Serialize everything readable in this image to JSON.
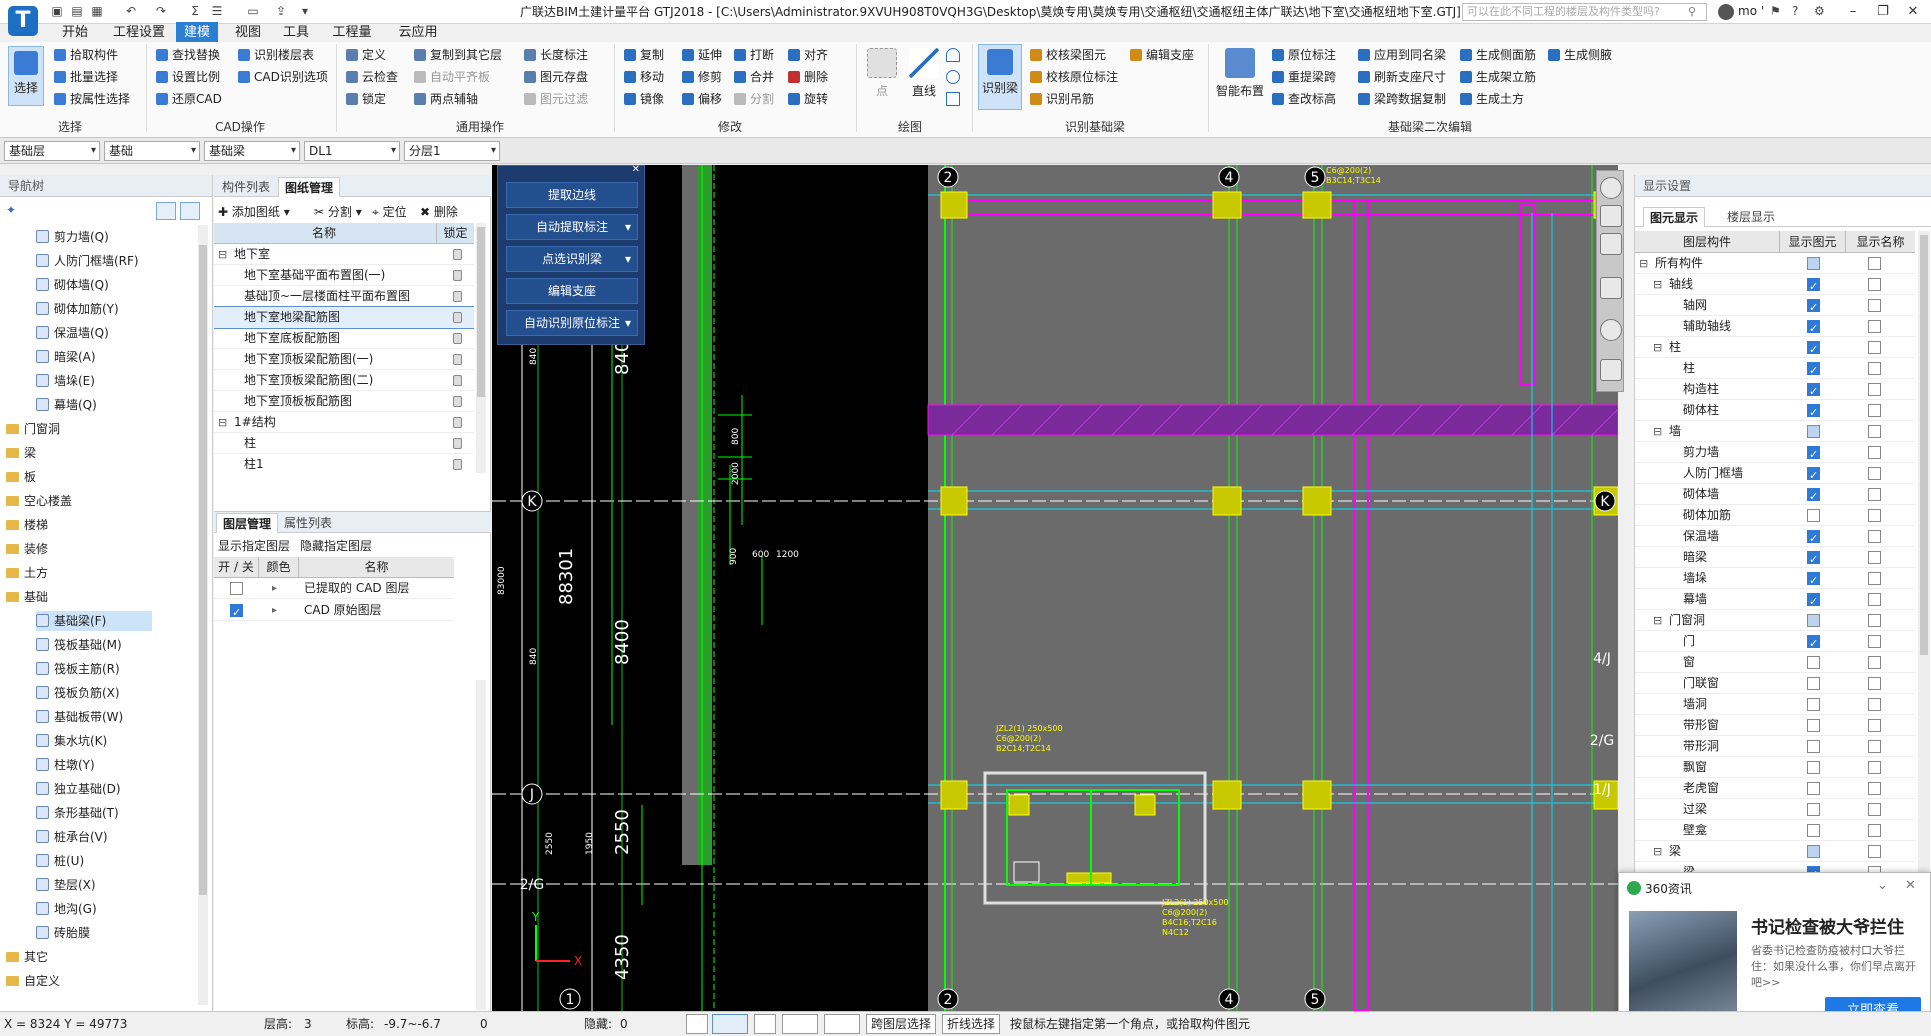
{
  "title": {
    "window_title": "广联达BIM土建计量平台 GTJ2018 - [C:\\Users\\Administrator.9XVUH908T0VQH3G\\Desktop\\莫焕专用\\莫焕专用\\交通枢纽\\交通枢纽主体广联达\\地下室\\交通枢纽地下室.GTJ]",
    "help_placeholder": "可以在此不同工程的楼层及构件类型吗?",
    "user": "mo '"
  },
  "menu": [
    "开始",
    "工程设置",
    "建模",
    "视图",
    "工具",
    "工程量",
    "云应用"
  ],
  "ribbon": {
    "select": {
      "big": "选择",
      "items": [
        "拾取构件",
        "批量选择",
        "按属性选择"
      ],
      "group": "选择"
    },
    "cad": {
      "items": [
        "查找替换",
        "识别楼层表",
        "设置比例",
        "CAD识别选项",
        "还原CAD"
      ],
      "group": "CAD操作"
    },
    "common": {
      "items": [
        "定义",
        "复制到其它层",
        "长度标注",
        "云检查",
        "自动平齐板",
        "图元存盘",
        "锁定",
        "两点辅轴",
        "图元过滤"
      ],
      "group": "通用操作"
    },
    "modify": {
      "items": [
        "复制",
        "延伸",
        "打断",
        "对齐",
        "移动",
        "修剪",
        "合并",
        "删除",
        "镜像",
        "偏移",
        "分割",
        "旋转"
      ],
      "group": "修改"
    },
    "draw": {
      "items": [
        "点",
        "直线"
      ],
      "group": "绘图"
    },
    "recog": {
      "big": "识别梁",
      "items": [
        "校核梁图元",
        "编辑支座",
        "校核原位标注",
        "识别吊筋"
      ],
      "group": "识别基础梁"
    },
    "second": {
      "big": "智能布置",
      "items": [
        "原位标注",
        "应用到同名梁",
        "生成侧面筋",
        "生成侧腋",
        "重提梁跨",
        "刷新支座尺寸",
        "生成架立筋",
        "查改标高",
        "梁跨数据复制",
        "生成土方"
      ],
      "group": "基础梁二次编辑"
    }
  },
  "selectors": [
    "基础层",
    "基础",
    "基础梁",
    "DL1",
    "分层1"
  ],
  "nav": {
    "header": "导航树",
    "items": [
      {
        "label": "剪力墙(Q)",
        "type": "icon",
        "level": 2
      },
      {
        "label": "人防门框墙(RF)",
        "type": "icon",
        "level": 2
      },
      {
        "label": "砌体墙(Q)",
        "type": "icon",
        "level": 2
      },
      {
        "label": "砌体加筋(Y)",
        "type": "icon",
        "level": 2
      },
      {
        "label": "保温墙(Q)",
        "type": "icon",
        "level": 2
      },
      {
        "label": "暗梁(A)",
        "type": "icon",
        "level": 2
      },
      {
        "label": "墙垛(E)",
        "type": "icon",
        "level": 2
      },
      {
        "label": "幕墙(Q)",
        "type": "icon",
        "level": 2
      },
      {
        "label": "门窗洞",
        "type": "fold",
        "level": 1
      },
      {
        "label": "梁",
        "type": "fold",
        "level": 1
      },
      {
        "label": "板",
        "type": "fold",
        "level": 1
      },
      {
        "label": "空心楼盖",
        "type": "fold",
        "level": 1
      },
      {
        "label": "楼梯",
        "type": "fold",
        "level": 1
      },
      {
        "label": "装修",
        "type": "fold",
        "level": 1
      },
      {
        "label": "土方",
        "type": "fold",
        "level": 1
      },
      {
        "label": "基础",
        "type": "fold",
        "level": 1
      },
      {
        "label": "基础梁(F)",
        "type": "icon",
        "level": 2,
        "selected": true
      },
      {
        "label": "筏板基础(M)",
        "type": "icon",
        "level": 2
      },
      {
        "label": "筏板主筋(R)",
        "type": "icon",
        "level": 2
      },
      {
        "label": "筏板负筋(X)",
        "type": "icon",
        "level": 2
      },
      {
        "label": "基础板带(W)",
        "type": "icon",
        "level": 2
      },
      {
        "label": "集水坑(K)",
        "type": "icon",
        "level": 2
      },
      {
        "label": "柱墩(Y)",
        "type": "icon",
        "level": 2
      },
      {
        "label": "独立基础(D)",
        "type": "icon",
        "level": 2
      },
      {
        "label": "条形基础(T)",
        "type": "icon",
        "level": 2
      },
      {
        "label": "桩承台(V)",
        "type": "icon",
        "level": 2
      },
      {
        "label": "桩(U)",
        "type": "icon",
        "level": 2
      },
      {
        "label": "垫层(X)",
        "type": "icon",
        "level": 2
      },
      {
        "label": "地沟(G)",
        "type": "icon",
        "level": 2
      },
      {
        "label": "砖胎膜",
        "type": "icon",
        "level": 2
      },
      {
        "label": "其它",
        "type": "fold",
        "level": 1
      },
      {
        "label": "自定义",
        "type": "fold",
        "level": 1
      }
    ]
  },
  "drawings": {
    "tabs": [
      "构件列表",
      "图纸管理"
    ],
    "toolbar": [
      "添加图纸",
      "分割",
      "定位",
      "删除"
    ],
    "col_name": "名称",
    "col_lock": "锁定",
    "rows": [
      {
        "label": "地下室",
        "indent": 0,
        "expand": true
      },
      {
        "label": "地下室基础平面布置图(一)",
        "indent": 1
      },
      {
        "label": "基础顶~一层楼面柱平面布置图",
        "indent": 1
      },
      {
        "label": "地下室地梁配筋图",
        "indent": 1,
        "selected": true
      },
      {
        "label": "地下室底板配筋图",
        "indent": 1
      },
      {
        "label": "地下室顶板梁配筋图(一)",
        "indent": 1
      },
      {
        "label": "地下室顶板梁配筋图(二)",
        "indent": 1
      },
      {
        "label": "地下室顶板板配筋图",
        "indent": 1
      },
      {
        "label": "1#结构",
        "indent": 0,
        "expand": true
      },
      {
        "label": "柱",
        "indent": 1
      },
      {
        "label": "柱1",
        "indent": 1
      }
    ]
  },
  "layers": {
    "tabs": [
      "图层管理",
      "属性列表"
    ],
    "toolbar": [
      "显示指定图层",
      "隐藏指定图层"
    ],
    "cols": [
      "开 / 关",
      "颜色",
      "名称"
    ],
    "rows": [
      {
        "label": "已提取的 CAD 图层",
        "on": false
      },
      {
        "label": "CAD 原始图层",
        "on": true
      }
    ]
  },
  "cad_buttons": [
    "提取边线",
    "自动提取标注",
    "点选识别梁",
    "编辑支座",
    "自动识别原位标注"
  ],
  "display": {
    "header": "显示设置",
    "tabs": [
      "图元显示",
      "楼层显示"
    ],
    "cols": [
      "图层构件",
      "显示图元",
      "显示名称"
    ],
    "rows": [
      {
        "label": "所有构件",
        "indent": 0,
        "a": "part",
        "b": "off"
      },
      {
        "label": "轴线",
        "indent": 1,
        "a": "on",
        "b": "off"
      },
      {
        "label": "轴网",
        "indent": 2,
        "a": "on",
        "b": "off"
      },
      {
        "label": "辅助轴线",
        "indent": 2,
        "a": "on",
        "b": "off"
      },
      {
        "label": "柱",
        "indent": 1,
        "a": "on",
        "b": "off"
      },
      {
        "label": "柱",
        "indent": 2,
        "a": "on",
        "b": "off"
      },
      {
        "label": "构造柱",
        "indent": 2,
        "a": "on",
        "b": "off"
      },
      {
        "label": "砌体柱",
        "indent": 2,
        "a": "on",
        "b": "off"
      },
      {
        "label": "墙",
        "indent": 1,
        "a": "part",
        "b": "off"
      },
      {
        "label": "剪力墙",
        "indent": 2,
        "a": "on",
        "b": "off"
      },
      {
        "label": "人防门框墙",
        "indent": 2,
        "a": "on",
        "b": "off"
      },
      {
        "label": "砌体墙",
        "indent": 2,
        "a": "on",
        "b": "off"
      },
      {
        "label": "砌体加筋",
        "indent": 2,
        "a": "off",
        "b": "off"
      },
      {
        "label": "保温墙",
        "indent": 2,
        "a": "on",
        "b": "off"
      },
      {
        "label": "暗梁",
        "indent": 2,
        "a": "on",
        "b": "off"
      },
      {
        "label": "墙垛",
        "indent": 2,
        "a": "on",
        "b": "off"
      },
      {
        "label": "幕墙",
        "indent": 2,
        "a": "on",
        "b": "off"
      },
      {
        "label": "门窗洞",
        "indent": 1,
        "a": "part",
        "b": "off"
      },
      {
        "label": "门",
        "indent": 2,
        "a": "on",
        "b": "off"
      },
      {
        "label": "窗",
        "indent": 2,
        "a": "off",
        "b": "off"
      },
      {
        "label": "门联窗",
        "indent": 2,
        "a": "off",
        "b": "off"
      },
      {
        "label": "墙洞",
        "indent": 2,
        "a": "off",
        "b": "off"
      },
      {
        "label": "带形窗",
        "indent": 2,
        "a": "off",
        "b": "off"
      },
      {
        "label": "带形洞",
        "indent": 2,
        "a": "off",
        "b": "off"
      },
      {
        "label": "飘窗",
        "indent": 2,
        "a": "off",
        "b": "off"
      },
      {
        "label": "老虎窗",
        "indent": 2,
        "a": "off",
        "b": "off"
      },
      {
        "label": "过梁",
        "indent": 2,
        "a": "off",
        "b": "off"
      },
      {
        "label": "壁龛",
        "indent": 2,
        "a": "off",
        "b": "off"
      },
      {
        "label": "梁",
        "indent": 1,
        "a": "part",
        "b": "off"
      },
      {
        "label": "梁",
        "indent": 2,
        "a": "on",
        "b": "off"
      }
    ]
  },
  "news": {
    "source": "360资讯",
    "headline": "书记检查被大爷拦住",
    "body": "省委书记检查防疫被村口大爷拦住：如果没什么事，你们早点离开吧>>",
    "button": "立即查看"
  },
  "status": {
    "coords": "X = 8324 Y = 49773",
    "floor_h": "层高:",
    "floor_val": "3",
    "elev": "标高:",
    "elev_val": "-9.7~-6.7",
    "zero": "0",
    "hidden": "隐藏:",
    "hidden_val": "0",
    "cross_select": "跨图层选择",
    "fold_select": "折线选择",
    "hint": "按鼠标左键指定第一个角点，或拾取构件图元"
  },
  "cad": {
    "axis_labels": [
      "1",
      "2",
      "4",
      "5",
      "K",
      "J",
      "2/G",
      "1/J",
      "2/G",
      "4/J"
    ],
    "dims": [
      "88301",
      "8400",
      "2550",
      "4350",
      "840",
      "840",
      "800",
      "2000",
      "900",
      "600",
      "1200",
      "1950",
      "2550"
    ],
    "beam_labels": [
      "JZL2(1) 250x500",
      "C6@200(2)",
      "B2C14;T2C14",
      "JZL2(1) 250x500",
      "C6@200(2)",
      "B4C16;T2C16",
      "N4C12",
      "JZL2(1)",
      "C6@200(2)",
      "B3C14;T3C14"
    ],
    "dim_side": [
      "83000",
      "8400",
      "2550"
    ]
  }
}
